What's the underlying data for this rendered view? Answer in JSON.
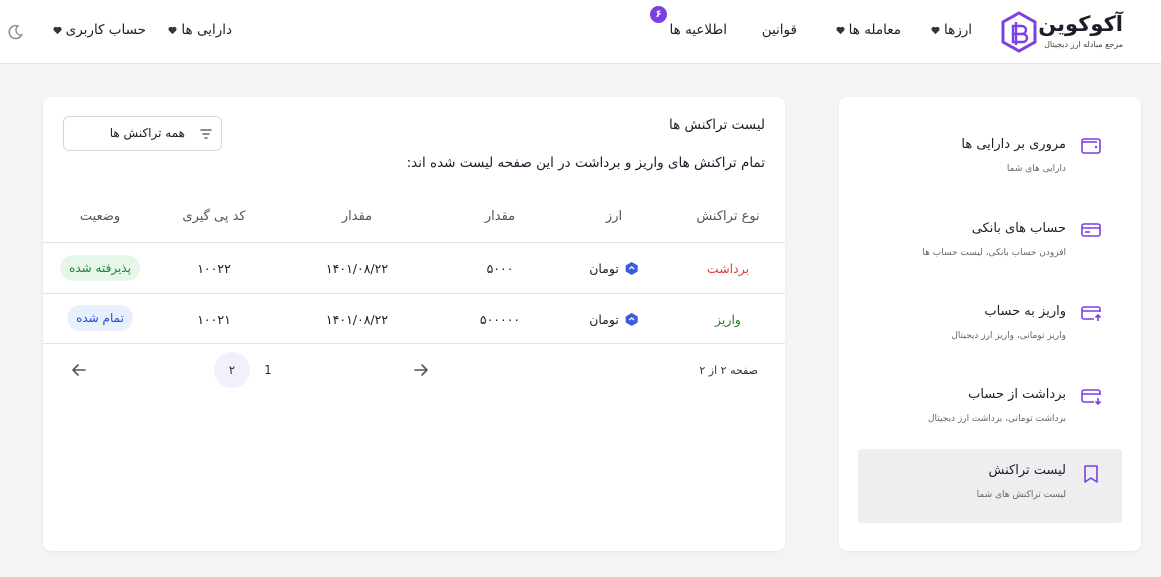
{
  "brand": {
    "name": "آکوکوین",
    "tagline": "مرجع مبادله ارز دیجیتال",
    "accent": "#7b3fe4"
  },
  "nav": {
    "currencies": "ارزها",
    "trades": "معامله ها",
    "rules": "قوانین",
    "notifications": "اطلاعیه ها",
    "notifications_count": "۶",
    "assets": "دارایی ها",
    "account": "حساب کاربری",
    "theme_icon": "moon-icon"
  },
  "sidebar": {
    "items": [
      {
        "label": "مروری بر دارایی ها",
        "sub": "دارایی های شما",
        "icon": "wallet-icon"
      },
      {
        "label": "حساب های بانکی",
        "sub": "افزودن حساب بانکی، لیست حساب ها",
        "icon": "card-icon"
      },
      {
        "label": "واریز به حساب",
        "sub": "واریز تومانی، واریز ارز دیجیتال",
        "icon": "card-deposit-icon"
      },
      {
        "label": "برداشت از حساب",
        "sub": "برداشت تومانی، برداشت ارز دیجیتال",
        "icon": "card-withdraw-icon"
      },
      {
        "label": "لیست تراکنش",
        "sub": "لیست تراکنش های شما",
        "icon": "bookmark-icon",
        "active": true
      }
    ]
  },
  "main": {
    "title": "لیست تراکنش ها",
    "description": "تمام تراکنش های واریز و برداشت در این صفحه لیست شده اند:",
    "filter": {
      "label": "همه تراکنش ها",
      "icon": "filter-icon"
    },
    "columns": [
      "نوع تراکنش",
      "ارز",
      "مقدار",
      "مقدار",
      "کد پی گیری",
      "وضعیت"
    ],
    "rows": [
      {
        "type": "برداشت",
        "type_color": "#e53935",
        "currency": "تومان",
        "amount": "۵۰۰۰",
        "date": "۱۴۰۱/۰۸/۲۲",
        "tracking": "۱۰۰۲۲",
        "status": "پذیرفته شده",
        "status_color": "#1e7e34",
        "status_bg": "#e6f7ea"
      },
      {
        "type": "واریز",
        "type_color": "#2e7d32",
        "currency": "تومان",
        "amount": "۵۰۰۰۰۰",
        "date": "۱۴۰۱/۰۸/۲۲",
        "tracking": "۱۰۰۲۱",
        "status": "تمام شده",
        "status_color": "#1a4fd6",
        "status_bg": "#e8effd"
      }
    ],
    "pagination": {
      "summary": "صفحه ۲ از ۲",
      "pages": [
        "۲",
        "1"
      ],
      "current": "۲"
    }
  }
}
